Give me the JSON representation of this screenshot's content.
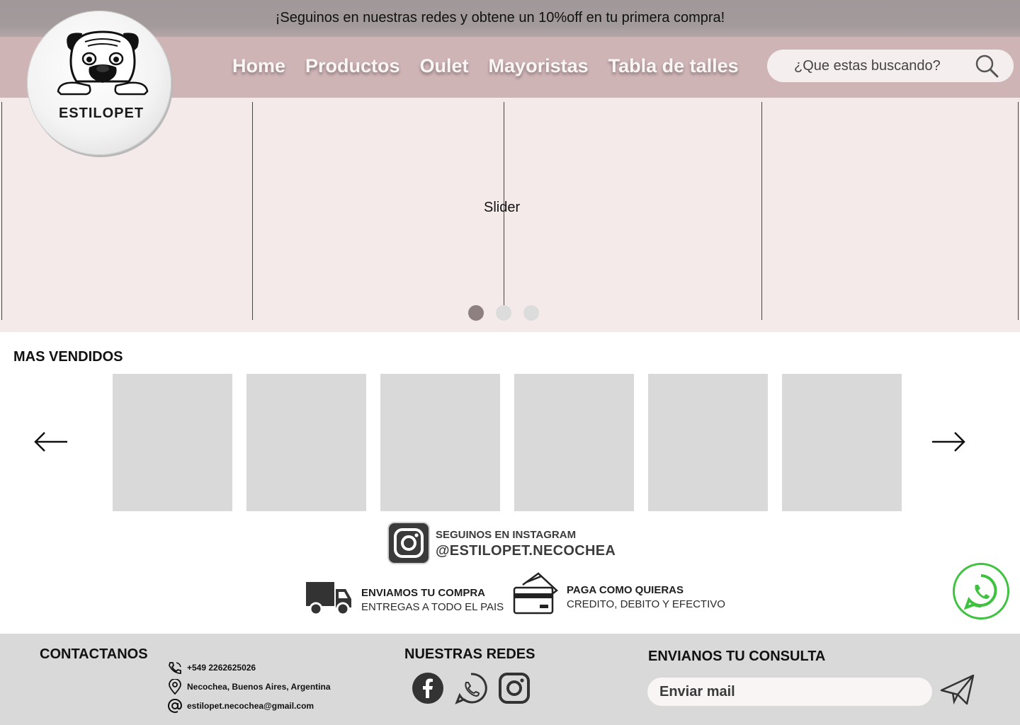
{
  "promo": {
    "text": "¡Seguinos en nuestras redes y obtene un 10%off en tu primera compra!"
  },
  "logo": {
    "brand": "ESTILOPET",
    "icon": "pug-dog-icon"
  },
  "nav": {
    "links": [
      "Home",
      "Productos",
      "Oulet",
      "Mayoristas",
      "Tabla de talles"
    ]
  },
  "search": {
    "placeholder": "¿Que estas buscando?",
    "value": "",
    "icon": "search-icon"
  },
  "slider": {
    "label": "Slider",
    "dots": 3,
    "active_dot": 0
  },
  "best_sellers": {
    "title": "MAS VENDIDOS",
    "product_count": 6,
    "prev_icon": "arrow-left-icon",
    "next_icon": "arrow-right-icon"
  },
  "instagram": {
    "label": "SEGUINOS EN INSTAGRAM",
    "handle": "@ESTILOPET.NECOCHEA"
  },
  "features": [
    {
      "icon": "truck-icon",
      "title": "ENVIAMOS TU COMPRA",
      "subtitle": "ENTREGAS A TODO EL PAIS"
    },
    {
      "icon": "credit-card-icon",
      "title": "PAGA COMO QUIERAS",
      "subtitle": "CREDITO, DEBITO Y EFECTIVO"
    }
  ],
  "footer": {
    "contact_title": "CONTACTANOS",
    "phone": "+549 2262625026",
    "address": "Necochea, Buenos Aires, Argentina",
    "email": "estilopet.necochea@gmail.com",
    "social_title": "NUESTRAS REDES",
    "social_icons": [
      "facebook-icon",
      "whatsapp-icon",
      "instagram-icon"
    ],
    "query_title": "ENVIANOS TU CONSULTA",
    "mail_placeholder": "Enviar mail"
  },
  "colors": {
    "promo_bar": "#a29a9b",
    "nav_bar": "#cfb4b6",
    "slider_bg": "#f4eaea",
    "dot_active": "#8e7f80",
    "product_placeholder": "#d9d9d9",
    "footer_bg": "#d9d9d9",
    "whatsapp_green": "#3fc23f"
  }
}
